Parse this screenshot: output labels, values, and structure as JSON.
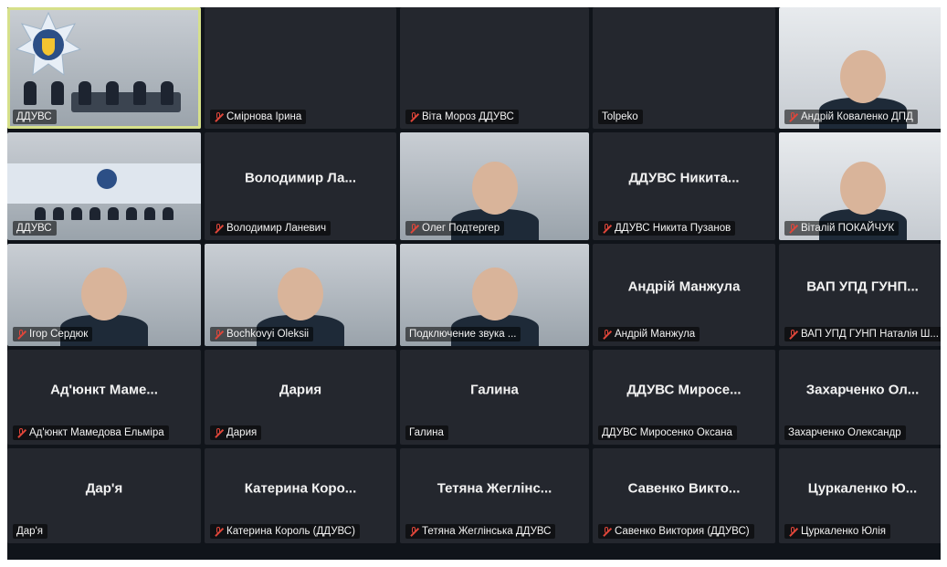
{
  "tiles": [
    {
      "label": "ДДУВС",
      "center": "",
      "video": "room",
      "muted": false,
      "active": true
    },
    {
      "label": "Смірнова Ірина",
      "center": "",
      "video": "none",
      "muted": true
    },
    {
      "label": "Віта Мороз ДДУВС",
      "center": "",
      "video": "none",
      "muted": true
    },
    {
      "label": "Tolpeko",
      "center": "",
      "video": "none",
      "muted": false
    },
    {
      "label": "Андрій Коваленко ДПД",
      "center": "",
      "video": "person",
      "muted": true
    },
    {
      "label": "ДДУВС",
      "center": "",
      "video": "hall",
      "muted": false
    },
    {
      "label": "Володимир Ланевич",
      "center": "Володимир Ла...",
      "video": "none",
      "muted": true
    },
    {
      "label": "Олег Подтергер",
      "center": "",
      "video": "person",
      "muted": true
    },
    {
      "label": "ДДУВС Никита Пузанов",
      "center": "ДДУВС Никита...",
      "video": "none",
      "muted": true
    },
    {
      "label": "Віталій ПОКАЙЧУК",
      "center": "",
      "video": "person",
      "muted": true
    },
    {
      "label": "Ігор Сердюк",
      "center": "",
      "video": "person",
      "muted": true
    },
    {
      "label": "Bochkovyi Oleksii",
      "center": "",
      "video": "person",
      "muted": true
    },
    {
      "label": "Подключение звука ...",
      "center": "",
      "video": "person",
      "muted": false
    },
    {
      "label": "Андрій Манжула",
      "center": "Андрій Манжула",
      "video": "none",
      "muted": true
    },
    {
      "label": "ВАП УПД ГУНП Наталія Ш...",
      "center": "ВАП УПД ГУНП...",
      "video": "none",
      "muted": true
    },
    {
      "label": "Ад'юнкт Мамедова Ельміра",
      "center": "Ад'юнкт Маме...",
      "video": "none",
      "muted": true
    },
    {
      "label": "Дария",
      "center": "Дария",
      "video": "none",
      "muted": true
    },
    {
      "label": "Галина",
      "center": "Галина",
      "video": "none",
      "muted": false
    },
    {
      "label": "ДДУВС Миросенко Оксана",
      "center": "ДДУВС Миросе...",
      "video": "none",
      "muted": false
    },
    {
      "label": "Захарченко Олександр",
      "center": "Захарченко Ол...",
      "video": "none",
      "muted": false
    },
    {
      "label": "Дар'я",
      "center": "Дар'я",
      "video": "none",
      "muted": false
    },
    {
      "label": "Катерина Король (ДДУВС)",
      "center": "Катерина Коро...",
      "video": "none",
      "muted": true
    },
    {
      "label": "Тетяна Жеглінська ДДУВС",
      "center": "Тетяна Жеглінс...",
      "video": "none",
      "muted": true
    },
    {
      "label": "Савенко Виктория (ДДУВС)",
      "center": "Савенко Викто...",
      "video": "none",
      "muted": true
    },
    {
      "label": "Цуркаленко Юлія",
      "center": "Цуркаленко Ю...",
      "video": "none",
      "muted": true
    }
  ],
  "colors": {
    "active_border": "#d6e08a",
    "muted_icon": "#e0463a",
    "tile_bg": "#24272e"
  }
}
